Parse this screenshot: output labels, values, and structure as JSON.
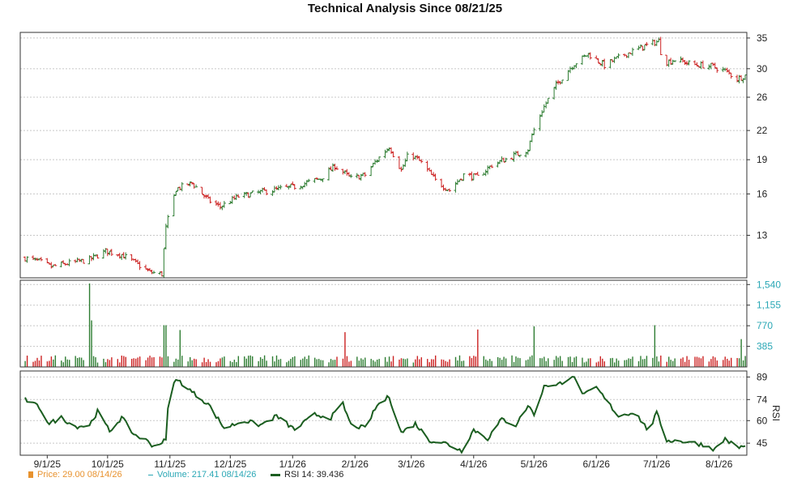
{
  "chart_data": [
    {
      "type": "ohlc",
      "panel": "price",
      "title": "Technical Analysis Since 08/21/25",
      "y_ticks": [
        13,
        16,
        19,
        22,
        26,
        30,
        35
      ],
      "y_scale": "log",
      "ylim": [
        10.5,
        36
      ],
      "date_start": "2025-08-21",
      "date_end": "2026-08-14",
      "x_ticks": [
        {
          "date": "2025-09-01",
          "label": "9/1/25"
        },
        {
          "date": "2025-10-01",
          "label": "10/1/25"
        },
        {
          "date": "2025-11-01",
          "label": "11/1/25"
        },
        {
          "date": "2025-12-01",
          "label": "12/1/25"
        },
        {
          "date": "2026-01-01",
          "label": "1/1/26"
        },
        {
          "date": "2026-02-01",
          "label": "2/1/26"
        },
        {
          "date": "2026-03-01",
          "label": "3/1/26"
        },
        {
          "date": "2026-04-01",
          "label": "4/1/26"
        },
        {
          "date": "2026-05-01",
          "label": "5/1/26"
        },
        {
          "date": "2026-06-01",
          "label": "6/1/26"
        },
        {
          "date": "2026-07-01",
          "label": "7/1/26"
        },
        {
          "date": "2026-08-01",
          "label": "8/1/26"
        }
      ],
      "series": [
        {
          "close_anchors": [
            [
              "2025-08-21",
              11.6
            ],
            [
              "2025-08-28",
              11.4
            ],
            [
              "2025-09-03",
              11.1
            ],
            [
              "2025-09-12",
              11.3
            ],
            [
              "2025-09-22",
              11.5
            ],
            [
              "2025-09-30",
              12.0
            ],
            [
              "2025-10-08",
              11.8
            ],
            [
              "2025-10-15",
              11.3
            ],
            [
              "2025-10-22",
              10.8
            ],
            [
              "2025-10-28",
              10.7
            ],
            [
              "2025-10-30",
              13.5
            ],
            [
              "2025-11-04",
              16.4
            ],
            [
              "2025-11-12",
              16.9
            ],
            [
              "2025-11-20",
              15.5
            ],
            [
              "2025-11-26",
              15.0
            ],
            [
              "2025-12-05",
              15.8
            ],
            [
              "2025-12-18",
              16.2
            ],
            [
              "2026-01-02",
              16.6
            ],
            [
              "2026-01-15",
              17.3
            ],
            [
              "2026-01-22",
              18.4
            ],
            [
              "2026-01-30",
              17.3
            ],
            [
              "2026-02-06",
              17.6
            ],
            [
              "2026-02-12",
              19.0
            ],
            [
              "2026-02-18",
              20.3
            ],
            [
              "2026-02-24",
              18.0
            ],
            [
              "2026-02-28",
              19.7
            ],
            [
              "2026-03-06",
              18.7
            ],
            [
              "2026-03-13",
              17.1
            ],
            [
              "2026-03-20",
              16.3
            ],
            [
              "2026-03-27",
              17.6
            ],
            [
              "2026-04-03",
              17.4
            ],
            [
              "2026-04-10",
              18.5
            ],
            [
              "2026-04-20",
              19.3
            ],
            [
              "2026-04-28",
              20.0
            ],
            [
              "2026-04-30",
              21.5
            ],
            [
              "2026-05-05",
              24.3
            ],
            [
              "2026-05-12",
              27.6
            ],
            [
              "2026-05-20",
              30.5
            ],
            [
              "2026-05-28",
              32.3
            ],
            [
              "2026-06-05",
              30.5
            ],
            [
              "2026-06-15",
              32.2
            ],
            [
              "2026-06-25",
              33.6
            ],
            [
              "2026-07-02",
              34.5
            ],
            [
              "2026-07-04",
              30.8
            ],
            [
              "2026-07-10",
              31.4
            ],
            [
              "2026-07-20",
              30.6
            ],
            [
              "2026-07-28",
              30.4
            ],
            [
              "2026-08-04",
              29.7
            ],
            [
              "2026-08-10",
              28.5
            ],
            [
              "2026-08-14",
              29.0
            ]
          ]
        }
      ]
    },
    {
      "type": "bar",
      "panel": "volume",
      "y_ticks": [
        385,
        770,
        1155,
        1540
      ],
      "y_tick_labels": [
        "385",
        "770",
        "1,155",
        "1,540"
      ],
      "ylim": [
        0,
        1620
      ],
      "baseline": 150,
      "spikes": [
        [
          "2025-09-22",
          1560
        ],
        [
          "2025-09-23",
          870
        ],
        [
          "2025-10-29",
          780
        ],
        [
          "2025-10-30",
          780
        ],
        [
          "2025-11-06",
          690
        ],
        [
          "2026-01-27",
          650
        ],
        [
          "2026-04-03",
          700
        ],
        [
          "2026-05-01",
          760
        ],
        [
          "2026-06-30",
          780
        ],
        [
          "2026-08-12",
          520
        ]
      ]
    },
    {
      "type": "line",
      "panel": "rsi",
      "y_ticks": [
        45,
        60,
        74,
        89
      ],
      "ylabel": "RSI",
      "ylim": [
        37,
        93
      ],
      "series": [
        {
          "values": [
            [
              "2025-08-21",
              74
            ],
            [
              "2025-08-28",
              69
            ],
            [
              "2025-09-02",
              58
            ],
            [
              "2025-09-08",
              62
            ],
            [
              "2025-09-15",
              56
            ],
            [
              "2025-09-22",
              57
            ],
            [
              "2025-09-26",
              66
            ],
            [
              "2025-10-02",
              53
            ],
            [
              "2025-10-08",
              62
            ],
            [
              "2025-10-14",
              51
            ],
            [
              "2025-10-20",
              47
            ],
            [
              "2025-10-24",
              43
            ],
            [
              "2025-10-30",
              47
            ],
            [
              "2025-11-01",
              87
            ],
            [
              "2025-11-06",
              86
            ],
            [
              "2025-11-12",
              79
            ],
            [
              "2025-11-20",
              71
            ],
            [
              "2025-11-28",
              55
            ],
            [
              "2025-12-08",
              60
            ],
            [
              "2025-12-16",
              57
            ],
            [
              "2025-12-24",
              63
            ],
            [
              "2026-01-02",
              54
            ],
            [
              "2026-01-12",
              64
            ],
            [
              "2026-01-20",
              62
            ],
            [
              "2026-01-26",
              71
            ],
            [
              "2026-01-30",
              57
            ],
            [
              "2026-02-06",
              55
            ],
            [
              "2026-02-12",
              70
            ],
            [
              "2026-02-18",
              76
            ],
            [
              "2026-02-24",
              52
            ],
            [
              "2026-03-03",
              58
            ],
            [
              "2026-03-10",
              47
            ],
            [
              "2026-03-18",
              45
            ],
            [
              "2026-03-26",
              40
            ],
            [
              "2026-04-01",
              54
            ],
            [
              "2026-04-08",
              48
            ],
            [
              "2026-04-15",
              61
            ],
            [
              "2026-04-22",
              57
            ],
            [
              "2026-04-28",
              70
            ],
            [
              "2026-05-02",
              63
            ],
            [
              "2026-05-06",
              84
            ],
            [
              "2026-05-12",
              83
            ],
            [
              "2026-05-20",
              90
            ],
            [
              "2026-05-26",
              77
            ],
            [
              "2026-06-01",
              82
            ],
            [
              "2026-06-05",
              75
            ],
            [
              "2026-06-12",
              63
            ],
            [
              "2026-06-20",
              66
            ],
            [
              "2026-06-27",
              53
            ],
            [
              "2026-07-01",
              65
            ],
            [
              "2026-07-06",
              47
            ],
            [
              "2026-07-16",
              46
            ],
            [
              "2026-07-24",
              44
            ],
            [
              "2026-07-30",
              41
            ],
            [
              "2026-08-04",
              48
            ],
            [
              "2026-08-10",
              42
            ],
            [
              "2026-08-14",
              43
            ]
          ]
        }
      ]
    }
  ],
  "colors": {
    "up": "#2e7d32",
    "down": "#cc2222",
    "rsi_line": "#1b5e20",
    "volume_axis": "#2aa7b5",
    "grid": "#c8c8c8",
    "frame": "#333333",
    "price_legend": "#e8922e"
  },
  "legend": {
    "price": "Price: 29.00  08/14/26",
    "volume": "Volume: 217.41  08/14/26",
    "rsi": "RSI 14: 39.436"
  }
}
